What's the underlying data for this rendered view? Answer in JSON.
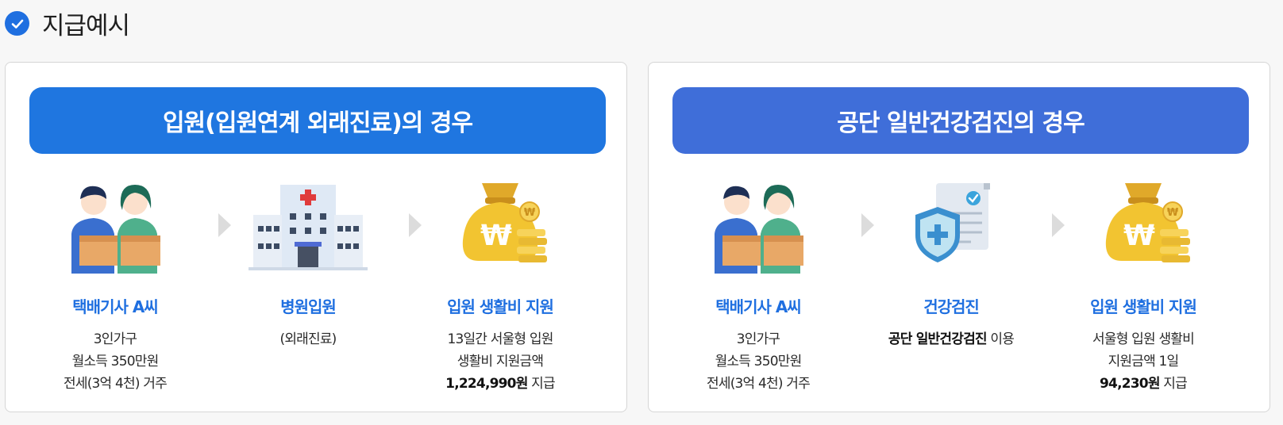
{
  "heading": {
    "title": "지급예시",
    "icon": "check-circle-icon"
  },
  "panels": [
    {
      "banner": "입원(입원연계 외래진료)의 경우",
      "banner_color": "#1f76e0",
      "steps": [
        {
          "icon": "delivery-workers-illustration",
          "title": "택배기사 A씨",
          "lines": [
            "3인가구",
            "월소득 350만원",
            "전세(3억 4천) 거주"
          ]
        },
        {
          "icon": "hospital-illustration",
          "title": "병원입원",
          "lines": [
            "(외래진료)"
          ]
        },
        {
          "icon": "money-bag-illustration",
          "title": "입원 생활비 지원",
          "lines": [
            "13일간 서울형 입원",
            "생활비 지원금액"
          ],
          "amount": "1,224,990원",
          "amount_suffix": " 지급"
        }
      ]
    },
    {
      "banner": "공단 일반건강검진의 경우",
      "banner_color": "#3f6ed9",
      "steps": [
        {
          "icon": "delivery-workers-illustration",
          "title": "택배기사 A씨",
          "lines": [
            "3인가구",
            "월소득 350만원",
            "전세(3억 4천) 거주"
          ]
        },
        {
          "icon": "health-checkup-document-illustration",
          "title": "건강검진",
          "bold_prefix": "공단 일반건강검진",
          "line_suffix": " 이용"
        },
        {
          "icon": "money-bag-illustration",
          "title": "입원 생활비 지원",
          "lines": [
            "서울형 입원 생활비",
            "지원금액 1일"
          ],
          "amount": "94,230원",
          "amount_suffix": " 지급"
        }
      ]
    }
  ],
  "colors": {
    "accent": "#1f6fe0",
    "border": "#d6d6d6",
    "arrow": "#dcdcdc",
    "gold": "#f2c431"
  }
}
